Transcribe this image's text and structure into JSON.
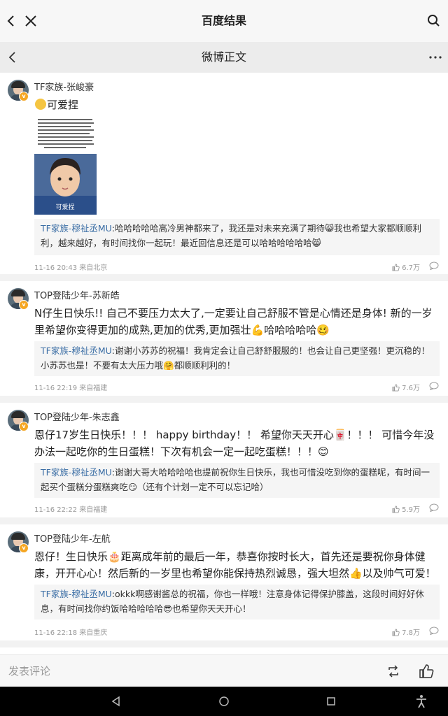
{
  "header": {
    "title": "百度结果"
  },
  "subheader": {
    "title": "微博正文"
  },
  "posts": [
    {
      "name": "TF家族-张峻豪",
      "text": "可爱捏",
      "image_caption": "可爱捏",
      "reply_who": "TF家族-穆祉丞MU",
      "reply_text": ":哈哈哈哈哈高冷男神都来了，我还是对未来充满了期待😸我也希望大家都顺顺利利，越来越好，有时间找你一起玩！最近回信息还是可以哈哈哈哈哈哈😸",
      "meta": "11-16 20:43 来自北京",
      "likes": "6.7万"
    },
    {
      "name": "TOP登陆少年-苏新皓",
      "text": "N仔生日快乐!! 自己不要压力太大了,一定要让自己舒服不管是心情还是身体! 新的一岁里希望你变得更加的成熟,更加的优秀,更加强壮💪哈哈哈哈哈🥴",
      "reply_who": "TF家族-穆祉丞MU",
      "reply_text": ":谢谢小苏苏的祝福！我肯定会让自己舒舒服服的！也会让自己更坚强！更沉稳的！小苏苏也是！不要有太大压力哦🤗都顺顺利利的！",
      "meta": "11-16 22:19 来自福建",
      "likes": "7.6万"
    },
    {
      "name": "TOP登陆少年-朱志鑫",
      "text": "恩仔17岁生日快乐！！！ happy birthday！！ 希望你天天开心🀄！！！ 可惜今年没办法一起吃你的生日蛋糕！下次有机会一定一起吃蛋糕！！！😊",
      "reply_who": "TF家族-穆祉丞MU",
      "reply_text": ":谢谢大哥大哈哈哈哈也提前祝你生日快乐，我也可惜没吃到你的蛋糕呢，有时间一起买个蛋糕分蛋糕爽吃😏（还有个计划一定不可以忘记哈）",
      "meta": "11-16 22:22 来自福建",
      "likes": "5.9万"
    },
    {
      "name": "TOP登陆少年-左航",
      "text": "恩仔！生日快乐🎂距离成年前的最后一年，恭喜你按时长大，首先还是要祝你身体健康，开开心心！然后新的一岁里也希望你能保持热烈诚恳，强大坦然👍以及帅气可爱！",
      "reply_who": "TF家族-穆祉丞MU",
      "reply_text": ":okkk啊感谢酱总的祝福，你也一样哦！注意身体记得保护膝盖，这段时间好好休息，有时间找你约饭哈哈哈哈哈😎也希望你天天开心！",
      "meta": "11-16 22:18 来自重庆",
      "likes": "7.8万"
    }
  ],
  "bottom": {
    "placeholder": "发表评论"
  },
  "icons": [
    "back-icon",
    "close-icon",
    "search-icon",
    "more-icon",
    "like-icon",
    "comment-icon",
    "repost-icon"
  ]
}
